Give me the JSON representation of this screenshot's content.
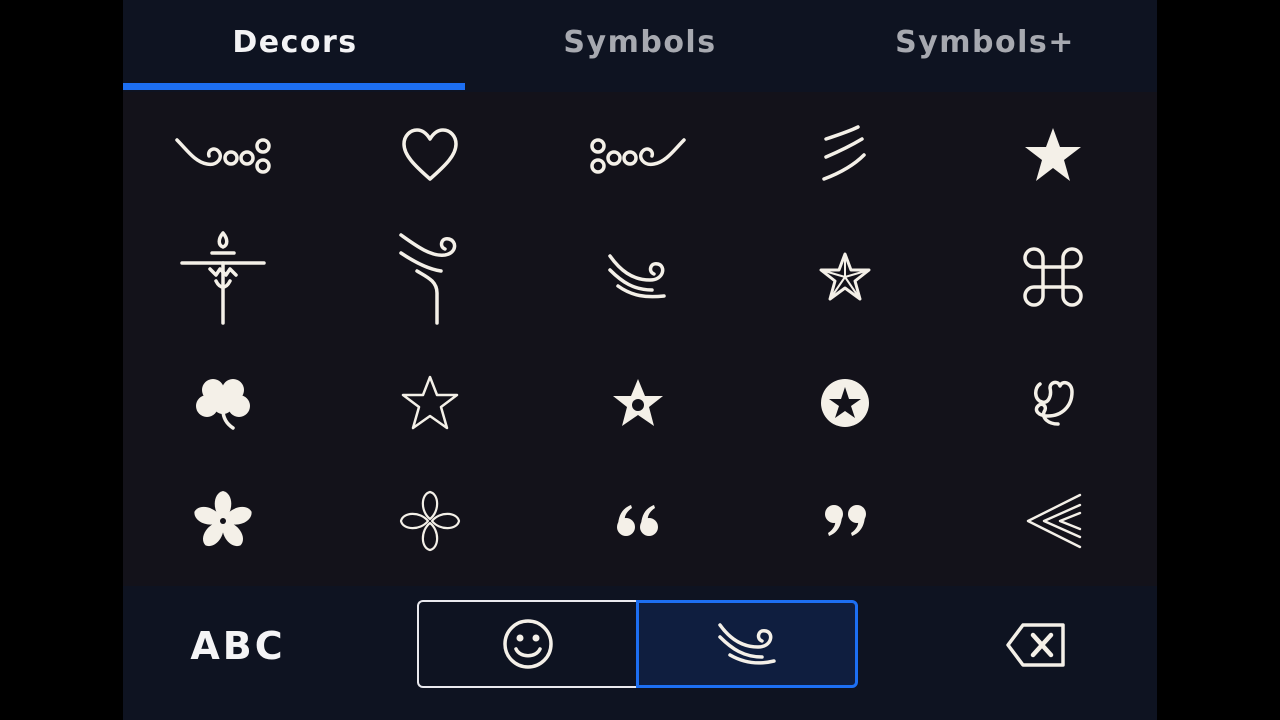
{
  "tabs": [
    {
      "label": "Decors",
      "active": true
    },
    {
      "label": "Symbols",
      "active": false
    },
    {
      "label": "Symbols+",
      "active": false
    }
  ],
  "colors": {
    "accent": "#1d6ff2",
    "background": "#13121a",
    "bar": "#0e1321",
    "glyph": "#f4f0e8"
  },
  "grid": {
    "rows": [
      [
        "swirl-dots-right-icon",
        "heart-outline-icon",
        "dots-swirl-left-icon",
        "triple-stroke-icon",
        "star-solid-icon"
      ],
      [
        "ornamental-cross-icon",
        "swirl-stem-icon",
        "swirl-wave-icon",
        "star-faceted-icon",
        "command-symbol-icon"
      ],
      [
        "shamrock-icon",
        "star-outline-icon",
        "star-dot-icon",
        "star-circle-icon",
        "swash-glyph-icon"
      ],
      [
        "flower-solid-icon",
        "flower-outline-icon",
        "quote-open-icon",
        "quote-close-icon",
        "chevrons-left-icon"
      ]
    ]
  },
  "bottom": {
    "abc_label": "ABC",
    "emoji_icon": "smiley-icon",
    "decor_icon": "swirl-icon",
    "delete_icon": "backspace-icon"
  }
}
